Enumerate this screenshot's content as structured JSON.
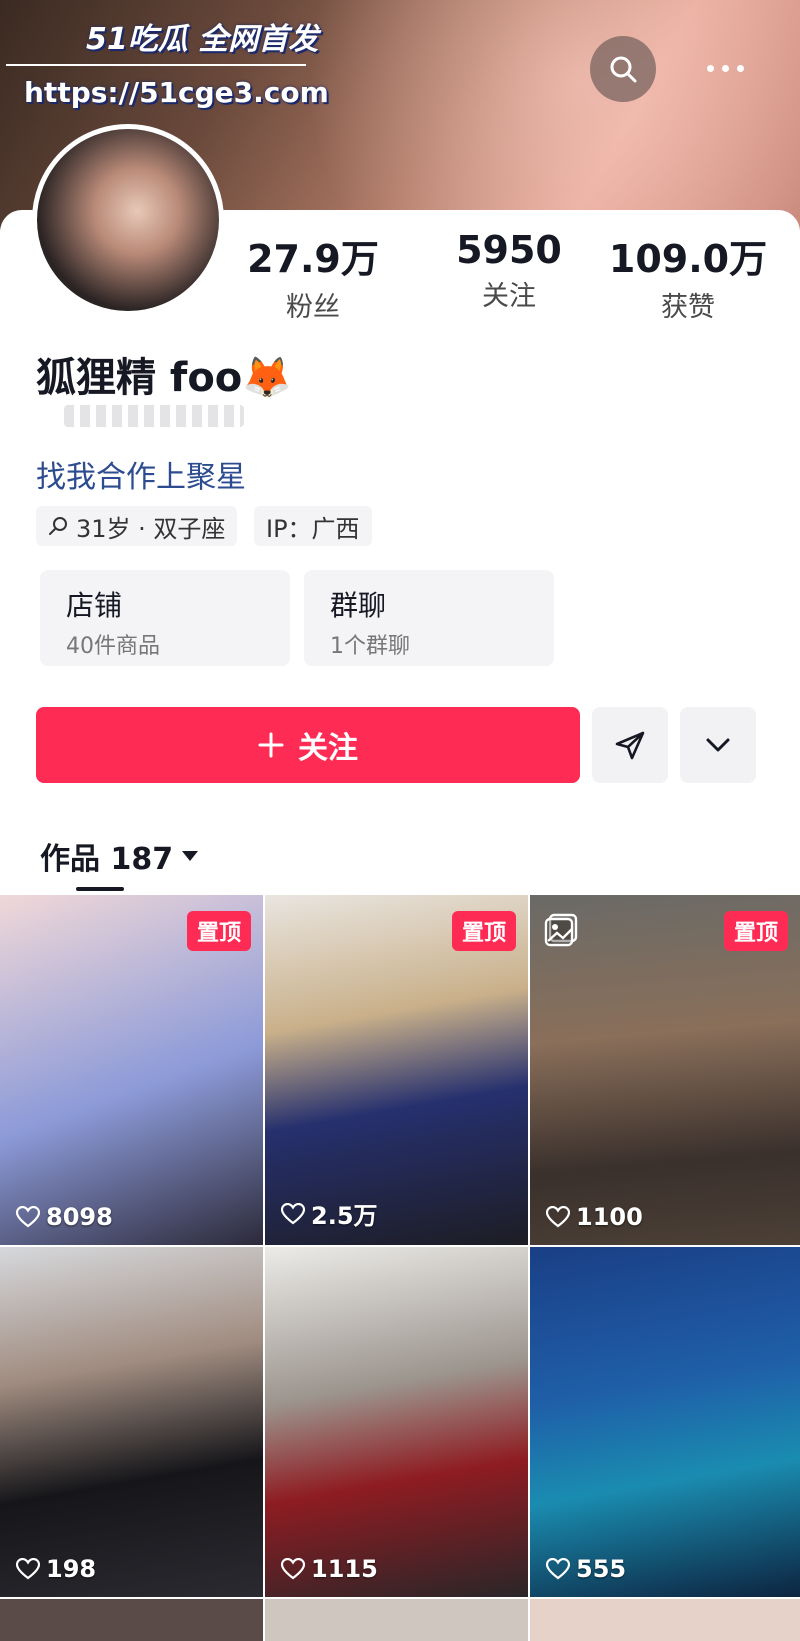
{
  "watermark": {
    "brand": "51吃瓜 全网首发",
    "url": "https://51cge3.com"
  },
  "profile": {
    "nickname": "狐狸精 foo🦊",
    "collab_link": "找我合作上聚星",
    "tags": [
      {
        "icon": "search-icon",
        "text": "31岁 · 双子座"
      },
      {
        "icon": "",
        "text": "IP：广西"
      }
    ]
  },
  "stats": [
    {
      "value": "27.9万",
      "label": "粉丝"
    },
    {
      "value": "5950",
      "label": "关注"
    },
    {
      "value": "109.0万",
      "label": "获赞"
    }
  ],
  "cards": [
    {
      "title": "店铺",
      "subtitle": "40件商品"
    },
    {
      "title": "群聊",
      "subtitle": "1个群聊"
    }
  ],
  "actions": {
    "follow_label": "关注",
    "share_icon": "send-icon",
    "more_icon": "chevron-down-icon"
  },
  "tabs": {
    "works_label": "作品 187"
  },
  "colors": {
    "accent": "#fe2c55",
    "link": "#2d4b8f",
    "text": "#161823"
  },
  "videos": [
    {
      "likes": "8098",
      "pinned": true,
      "pin_label": "置顶",
      "is_album": false
    },
    {
      "likes": "2.5万",
      "pinned": true,
      "pin_label": "置顶",
      "is_album": false
    },
    {
      "likes": "1100",
      "pinned": true,
      "pin_label": "置顶",
      "is_album": true
    },
    {
      "likes": "198",
      "pinned": false,
      "is_album": false
    },
    {
      "likes": "1115",
      "pinned": false,
      "is_album": false
    },
    {
      "likes": "555",
      "pinned": false,
      "is_album": false
    }
  ]
}
